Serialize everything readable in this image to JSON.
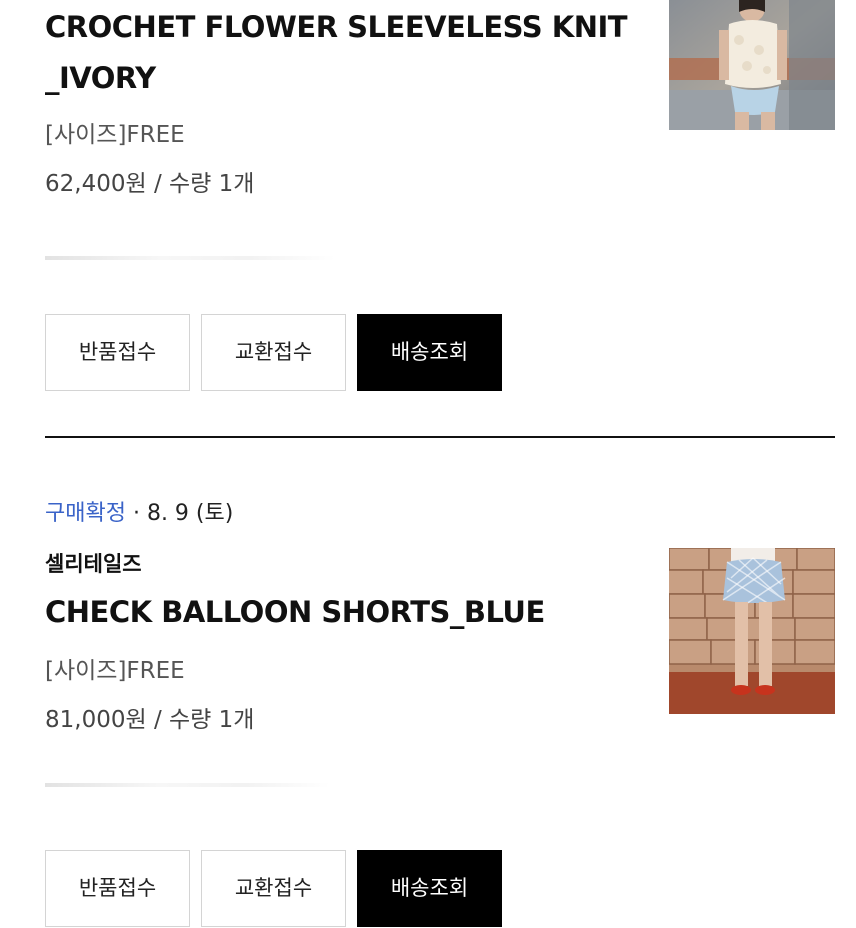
{
  "orders": [
    {
      "product_name": "CROCHET FLOWER SLEEVELESS KNIT_IVORY",
      "option": "[사이즈]FREE",
      "price_line": "62,400원 / 수량 1개",
      "thumbnail_icon": "product-photo-knit",
      "actions": {
        "return_label": "반품접수",
        "exchange_label": "교환접수",
        "tracking_label": "배송조회"
      }
    },
    {
      "status_label": "구매확정",
      "status_date": " · 8. 9 (토)",
      "brand": "셀리테일즈",
      "product_name": "CHECK BALLOON SHORTS_BLUE",
      "option": "[사이즈]FREE",
      "price_line": "81,000원 / 수량 1개",
      "thumbnail_icon": "product-photo-shorts",
      "actions": {
        "return_label": "반품접수",
        "exchange_label": "교환접수",
        "tracking_label": "배송조회"
      }
    }
  ],
  "colors": {
    "status_blue": "#3a63c8",
    "primary_button": "#000000",
    "divider": "#111111"
  }
}
